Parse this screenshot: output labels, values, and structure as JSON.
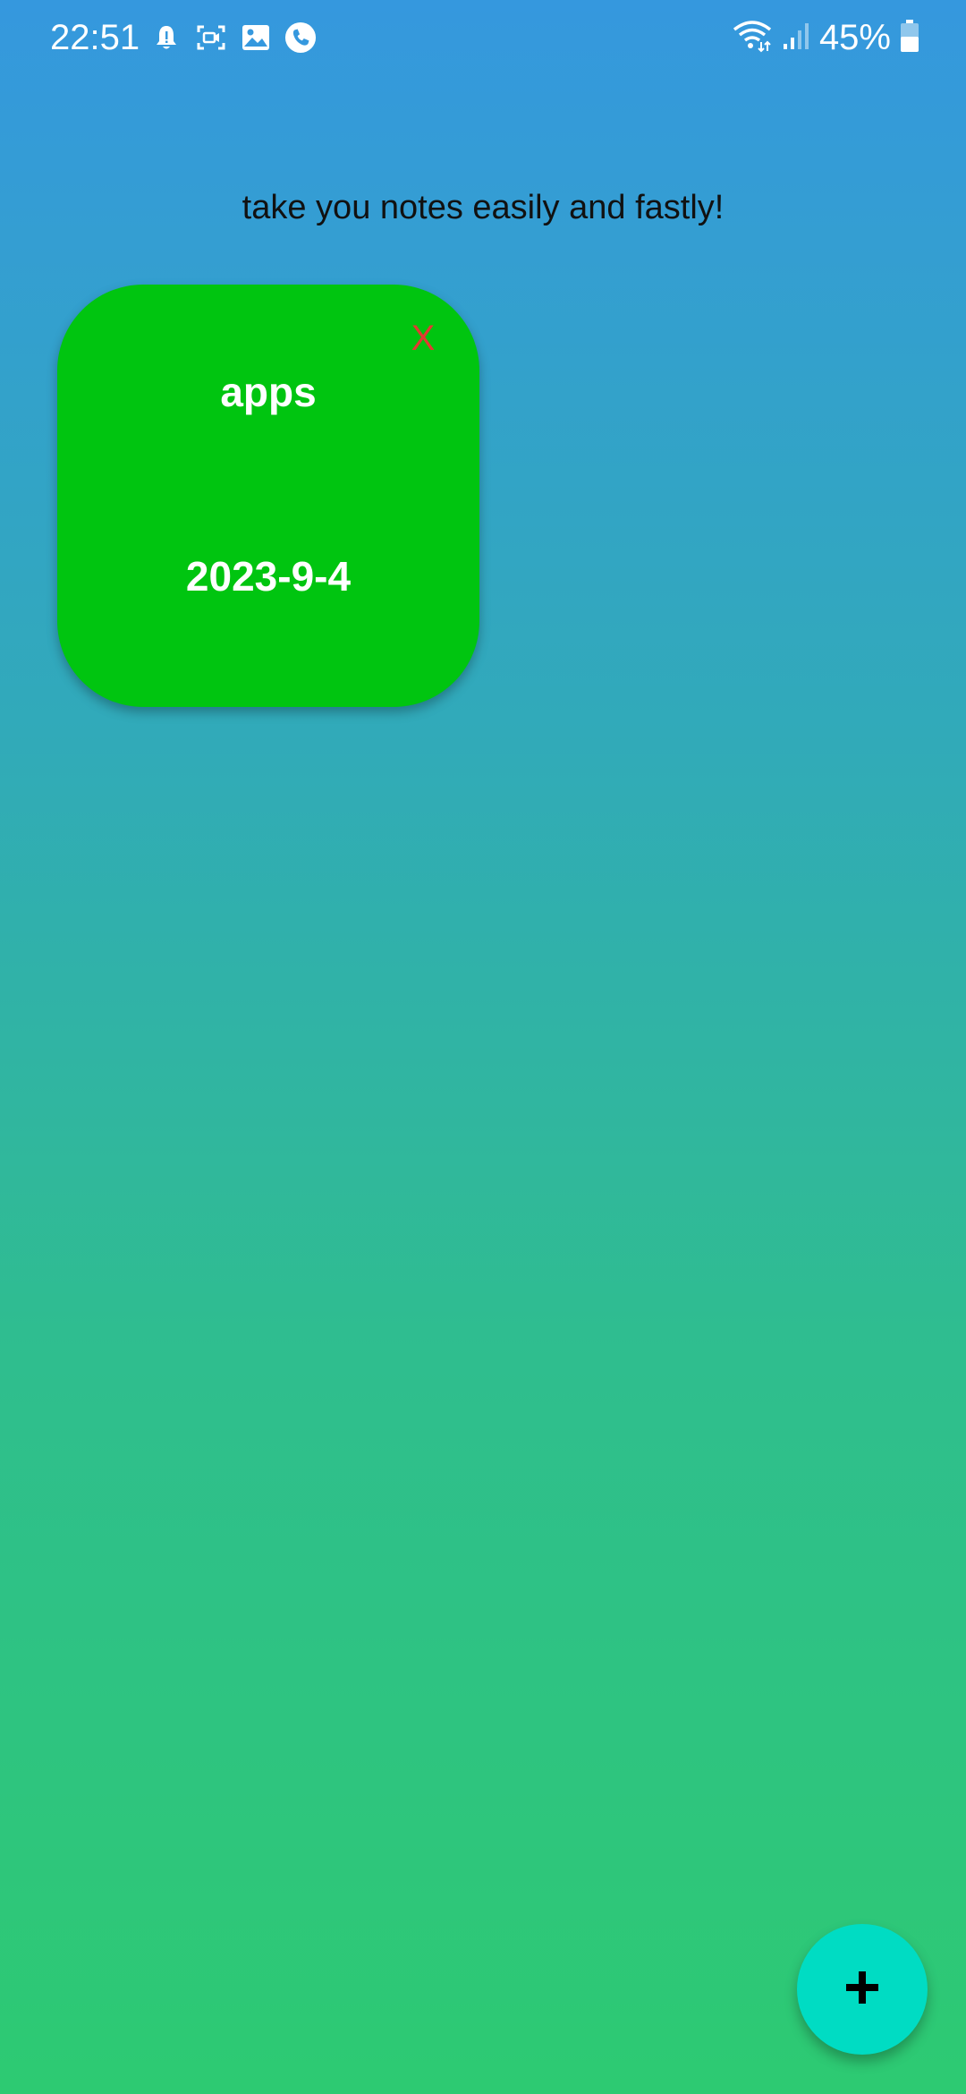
{
  "status_bar": {
    "time": "22:51",
    "left_icons": [
      "alarm-bell-icon",
      "screen-record-icon",
      "gallery-icon",
      "phone-call-icon"
    ],
    "right_icons": [
      "wifi-icon",
      "cellular-signal-icon",
      "battery-icon"
    ],
    "battery_percent": "45%"
  },
  "header": {
    "tagline": "take you notes easily and fastly!"
  },
  "notes": [
    {
      "title": "apps",
      "date": "2023-9-4",
      "delete_label": "X",
      "color": "#00c510"
    }
  ],
  "fab": {
    "icon": "plus-icon",
    "color": "#00dcc3"
  },
  "colors": {
    "background_top": "#3598de",
    "background_bottom": "#2dca72",
    "delete_x": "#e13a31"
  }
}
